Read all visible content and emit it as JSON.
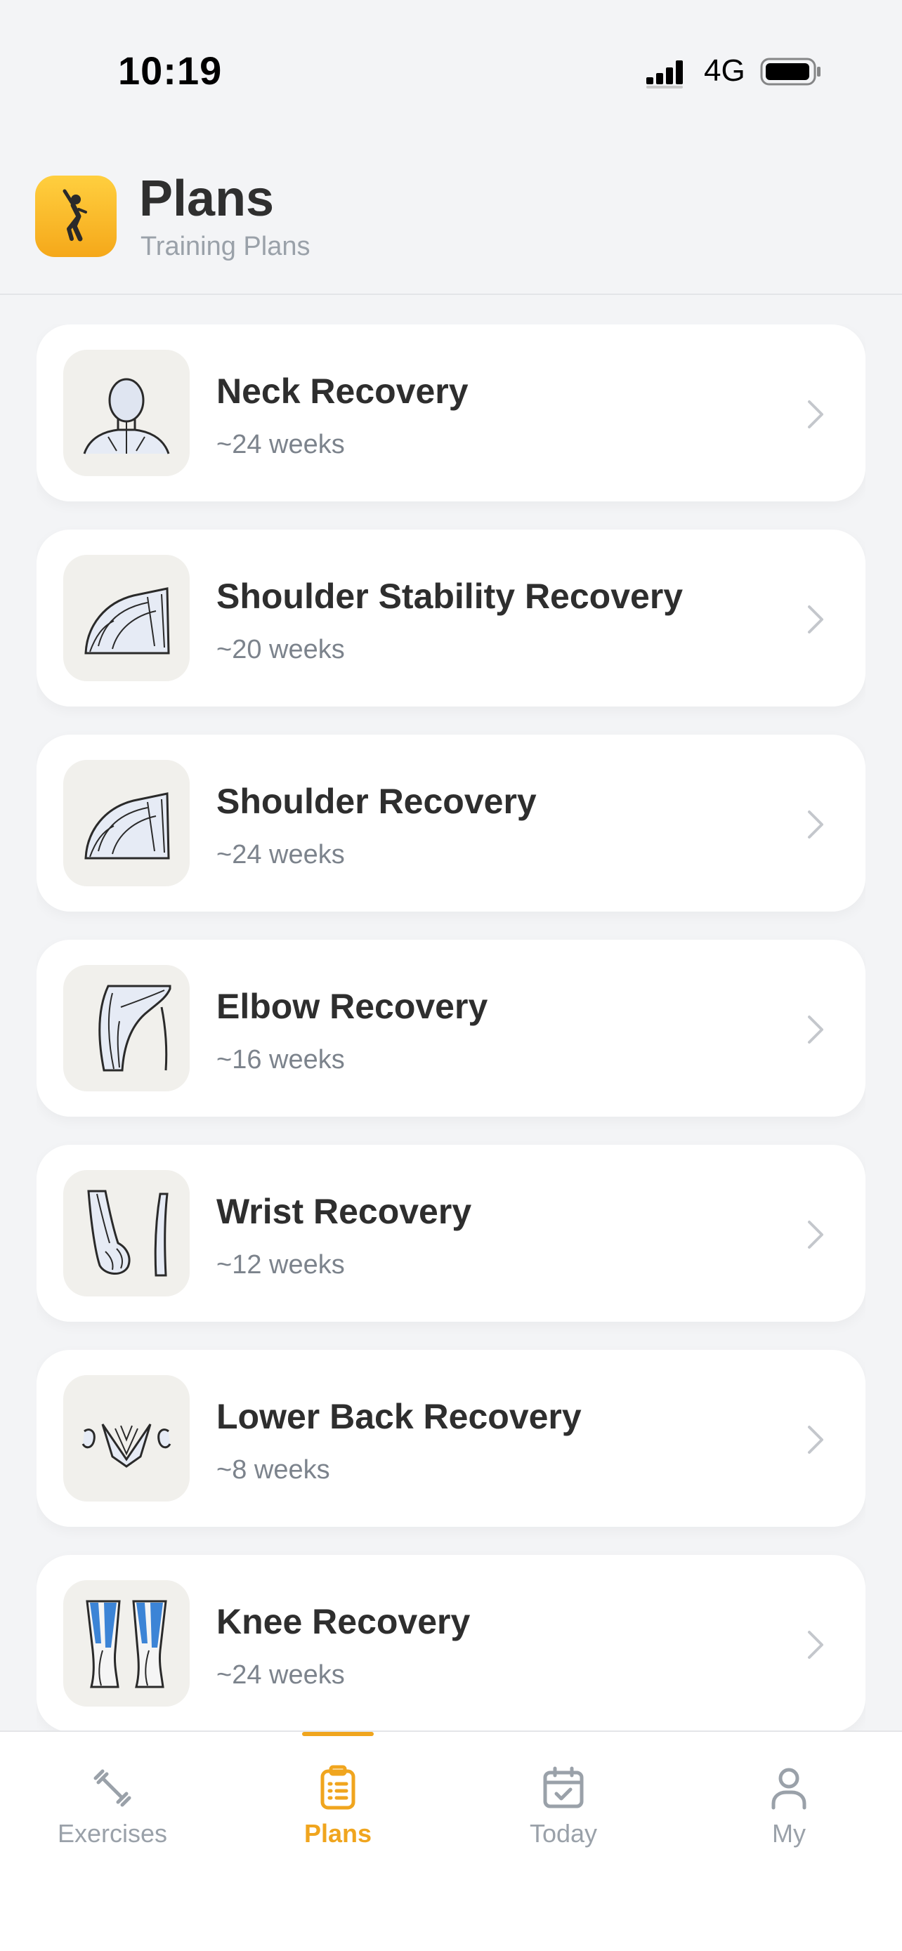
{
  "status_bar": {
    "time": "10:19",
    "network": "4G",
    "icons": [
      "signal-icon",
      "battery-icon"
    ]
  },
  "header": {
    "title": "Plans",
    "subtitle": "Training Plans",
    "logo_icon": "stretching-figure-icon"
  },
  "colors": {
    "accent": "#f0a51e",
    "background": "#f3f4f6",
    "card": "#ffffff",
    "muted": "#9aa1a9"
  },
  "plans": [
    {
      "name": "Neck Recovery",
      "duration": "~24 weeks",
      "image": "neck-anatomy"
    },
    {
      "name": "Shoulder Stability Recovery",
      "duration": "~20 weeks",
      "image": "shoulder-anatomy"
    },
    {
      "name": "Shoulder Recovery",
      "duration": "~24 weeks",
      "image": "shoulder-anatomy"
    },
    {
      "name": "Elbow Recovery",
      "duration": "~16 weeks",
      "image": "elbow-anatomy"
    },
    {
      "name": "Wrist Recovery",
      "duration": "~12 weeks",
      "image": "wrist-anatomy"
    },
    {
      "name": "Lower Back Recovery",
      "duration": "~8 weeks",
      "image": "lower-back-anatomy"
    },
    {
      "name": "Knee Recovery",
      "duration": "~24 weeks",
      "image": "knee-anatomy"
    }
  ],
  "tabs": [
    {
      "label": "Exercises",
      "icon": "dumbbell-icon",
      "active": false
    },
    {
      "label": "Plans",
      "icon": "clipboard-list-icon",
      "active": true
    },
    {
      "label": "Today",
      "icon": "calendar-check-icon",
      "active": false
    },
    {
      "label": "My",
      "icon": "person-icon",
      "active": false
    }
  ]
}
